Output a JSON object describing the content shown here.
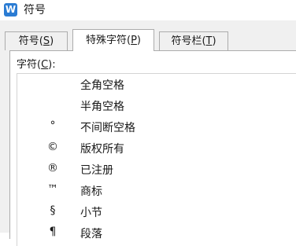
{
  "window": {
    "icon_letter": "W",
    "title": "符号"
  },
  "tabs": [
    {
      "label": "符号",
      "mnemonic": "S"
    },
    {
      "label": "特殊字符",
      "mnemonic": "P"
    },
    {
      "label": "符号栏",
      "mnemonic": "T"
    }
  ],
  "active_tab": 1,
  "panel": {
    "char_label": "字符",
    "char_mnemonic": "C"
  },
  "characters": [
    {
      "symbol": "",
      "name": "全角空格"
    },
    {
      "symbol": "",
      "name": "半角空格"
    },
    {
      "symbol": "°",
      "name": "不间断空格"
    },
    {
      "symbol": "©",
      "name": "版权所有"
    },
    {
      "symbol": "®",
      "name": "已注册"
    },
    {
      "symbol": "™",
      "name": "商标"
    },
    {
      "symbol": "§",
      "name": "小节"
    },
    {
      "symbol": "¶",
      "name": "段落"
    }
  ],
  "colors": {
    "app_icon": "#2b7cd3",
    "tab_border": "#acacac",
    "dialog_bg": "#f0f0f0"
  }
}
